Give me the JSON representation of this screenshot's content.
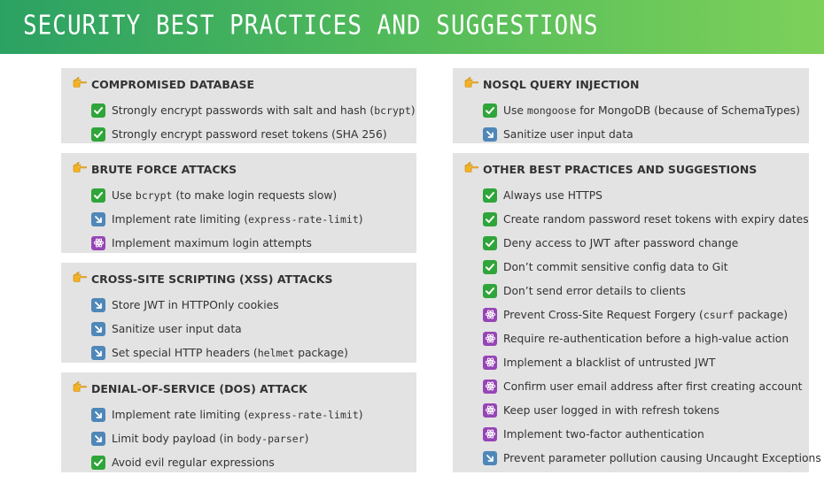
{
  "title": "SECURITY BEST PRACTICES AND SUGGESTIONS",
  "sections": [
    {
      "id": "compromised-database",
      "title": "COMPROMISED DATABASE",
      "items": [
        {
          "icon": "check",
          "parts": [
            {
              "t": "Strongly encrypt passwords with salt and hash ("
            },
            {
              "t": "bcrypt",
              "code": true
            },
            {
              "t": ")"
            }
          ]
        },
        {
          "icon": "check",
          "parts": [
            {
              "t": "Strongly encrypt password reset tokens (SHA 256)"
            }
          ]
        }
      ]
    },
    {
      "id": "brute-force-attacks",
      "title": "BRUTE FORCE ATTACKS",
      "items": [
        {
          "icon": "check",
          "parts": [
            {
              "t": "Use "
            },
            {
              "t": "bcrypt",
              "code": true
            },
            {
              "t": " (to make login requests slow)"
            }
          ]
        },
        {
          "icon": "arrow",
          "parts": [
            {
              "t": "Implement rate limiting ("
            },
            {
              "t": "express-rate-limit",
              "code": true
            },
            {
              "t": ")"
            }
          ]
        },
        {
          "icon": "atom",
          "parts": [
            {
              "t": "Implement maximum login attempts"
            }
          ]
        }
      ]
    },
    {
      "id": "xss-attacks",
      "title": "CROSS-SITE SCRIPTING (XSS) ATTACKS",
      "items": [
        {
          "icon": "arrow",
          "parts": [
            {
              "t": "Store JWT in HTTPOnly cookies"
            }
          ]
        },
        {
          "icon": "arrow",
          "parts": [
            {
              "t": "Sanitize user input data"
            }
          ]
        },
        {
          "icon": "arrow",
          "parts": [
            {
              "t": "Set special HTTP headers ("
            },
            {
              "t": "helmet",
              "code": true
            },
            {
              "t": " package)"
            }
          ]
        }
      ]
    },
    {
      "id": "dos-attack",
      "title": "DENIAL-OF-SERVICE (DOS) ATTACK",
      "items": [
        {
          "icon": "arrow",
          "parts": [
            {
              "t": "Implement rate limiting ("
            },
            {
              "t": "express-rate-limit",
              "code": true
            },
            {
              "t": ")"
            }
          ]
        },
        {
          "icon": "arrow",
          "parts": [
            {
              "t": "Limit body payload (in "
            },
            {
              "t": "body-parser",
              "code": true
            },
            {
              "t": ")"
            }
          ]
        },
        {
          "icon": "check",
          "parts": [
            {
              "t": "Avoid evil regular expressions"
            }
          ]
        }
      ]
    },
    {
      "id": "nosql-query-injection",
      "title": "NOSQL QUERY INJECTION",
      "items": [
        {
          "icon": "check",
          "parts": [
            {
              "t": "Use "
            },
            {
              "t": "mongoose",
              "code": true
            },
            {
              "t": " for MongoDB (because of SchemaTypes)"
            }
          ]
        },
        {
          "icon": "arrow",
          "parts": [
            {
              "t": "Sanitize user input data"
            }
          ]
        }
      ]
    },
    {
      "id": "other-best-practices",
      "title": "OTHER BEST PRACTICES AND SUGGESTIONS",
      "items": [
        {
          "icon": "check",
          "parts": [
            {
              "t": "Always use HTTPS"
            }
          ]
        },
        {
          "icon": "check",
          "parts": [
            {
              "t": "Create random password reset tokens with expiry dates"
            }
          ]
        },
        {
          "icon": "check",
          "parts": [
            {
              "t": "Deny access to JWT after password change"
            }
          ]
        },
        {
          "icon": "check",
          "parts": [
            {
              "t": "Don’t commit sensitive config data to Git"
            }
          ]
        },
        {
          "icon": "check",
          "parts": [
            {
              "t": "Don’t send error details to clients"
            }
          ]
        },
        {
          "icon": "atom",
          "parts": [
            {
              "t": "Prevent Cross-Site Request Forgery ("
            },
            {
              "t": "csurf",
              "code": true
            },
            {
              "t": " package)"
            }
          ]
        },
        {
          "icon": "atom",
          "parts": [
            {
              "t": "Require re-authentication before a high-value action"
            }
          ]
        },
        {
          "icon": "atom",
          "parts": [
            {
              "t": "Implement a blacklist of untrusted JWT"
            }
          ]
        },
        {
          "icon": "atom",
          "parts": [
            {
              "t": "Confirm user email address after first creating account"
            }
          ]
        },
        {
          "icon": "atom",
          "parts": [
            {
              "t": "Keep user logged in with refresh tokens"
            }
          ]
        },
        {
          "icon": "atom",
          "parts": [
            {
              "t": "Implement two-factor authentication"
            }
          ]
        },
        {
          "icon": "arrow",
          "parts": [
            {
              "t": "Prevent parameter pollution causing Uncaught Exceptions"
            }
          ]
        }
      ]
    }
  ]
}
